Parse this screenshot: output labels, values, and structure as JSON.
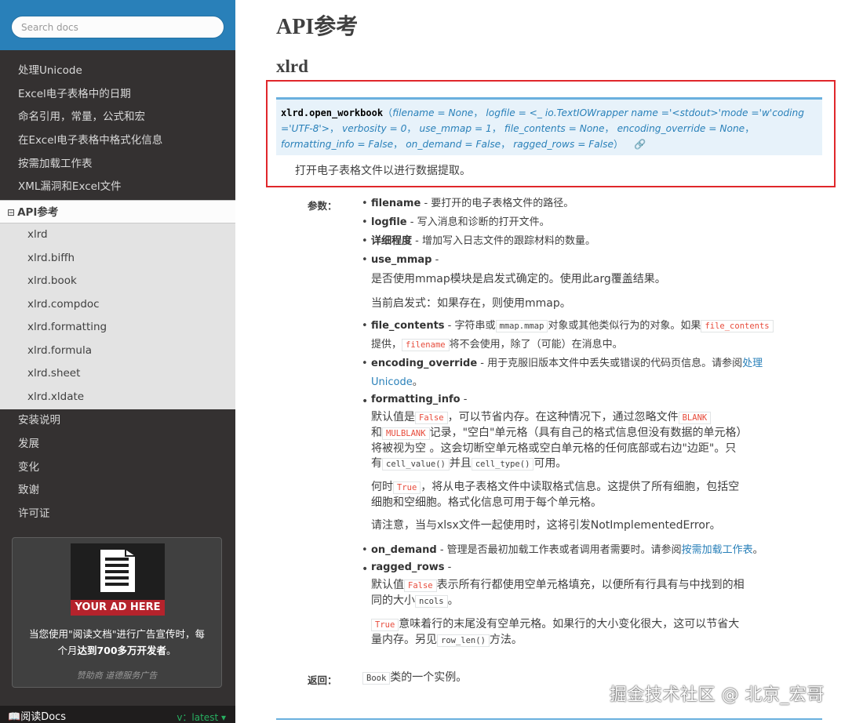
{
  "sidebar": {
    "search_placeholder": "Search docs",
    "nav_top": [
      "处理Unicode",
      "Excel电子表格中的日期",
      "命名引用，常量，公式和宏",
      "在Excel电子表格中格式化信息",
      "按需加载工作表",
      "XML漏洞和Excel文件"
    ],
    "current": {
      "toggle": "⊟",
      "label": "API参考"
    },
    "sub_items": [
      "xlrd",
      "xlrd.biffh",
      "xlrd.book",
      "xlrd.compdoc",
      "xlrd.formatting",
      "xlrd.formula",
      "xlrd.sheet",
      "xlrd.xldate"
    ],
    "nav_bottom": [
      "安装说明",
      "发展",
      "变化",
      "致谢",
      "许可证"
    ],
    "ad": {
      "banner": "YOUR AD HERE",
      "line1": "当您使用\"阅读文档\"进行广告宣传时，每",
      "line2a": "个月",
      "line2b": "达到700多万开发者",
      "line2c": "。",
      "footer": "赞助商 道德服务广告"
    },
    "rtd": {
      "left": "阅读Docs",
      "right": "v：latest ▾"
    }
  },
  "main": {
    "h1": "API参考",
    "h2": "xlrd",
    "sig": {
      "name": "xlrd.open_workbook",
      "paren_open": "（",
      "params": [
        "filename = None",
        "logfile = <_ io.TextIOWrapper name ='<stdout>'mode ='w'coding ='UTF-8'>",
        "verbosity = 0",
        "use_mmap = 1",
        "file_contents = None",
        "encoding_override = None",
        "formatting_info = False",
        "on_demand = False",
        "ragged_rows = False"
      ],
      "paren_close": "）",
      "link_icon": "🔗"
    },
    "description": "打开电子表格文件以进行数据提取。",
    "params_label": "参数：",
    "returns_label": "返回：",
    "params": {
      "filename": {
        "name": "filename",
        "text": " - 要打开的电子表格文件的路径。"
      },
      "logfile": {
        "name": "logfile",
        "text": " - 写入消息和诊断的打开文件。"
      },
      "verbosity": {
        "name": "详细程度",
        "text": " - 增加写入日志文件的跟踪材料的数量。"
      },
      "use_mmap": {
        "name": "use_mmap",
        "text": " -",
        "l2": "是否使用mmap模块是启发式确定的。使用此arg覆盖结果。",
        "l3": "当前启发式：如果存在，则使用mmap。"
      },
      "file_contents": {
        "name": "file_contents",
        "t1": " - 字符串或",
        "c1": "mmap.mmap",
        "t2": "对象或其他类似行为的对象。如果",
        "c2": "file_contents",
        "t3": "提供，",
        "c3": "filename",
        "t4": "将不会使用，除了（可能）在消息中。"
      },
      "encoding_override": {
        "name": "encoding_override",
        "t1": " - 用于克服旧版本文件中丢失或错误的代码页信息。请参阅",
        "link1": "处理",
        "link2": "Unicode",
        "t2": "。"
      },
      "formatting_info": {
        "name": "formatting_info",
        "t0": " -",
        "a1": "默认值是",
        "c1": "False",
        "a2": "，可以节省内存。在这种情况下，通过忽略文件",
        "c2": "BLANK",
        "b1": "和",
        "c3": "MULBLANK",
        "b2": "记录，\"空白\"单元格（具有自己的格式信息但没有数据的单元格）",
        "d1": "将被视为空 。这会切断空单元格或空白单元格的任何底部或右边\"边距\"。只",
        "e1": "有",
        "c4": "cell_value()",
        "e2": "并且",
        "c5": "cell_type()",
        "e3": "可用。",
        "f1": "何时",
        "c6": "True",
        "f2": "，将从电子表格文件中读取格式信息。这提供了所有细胞，包括空",
        "g1": "细胞和空细胞。格式化信息可用于每个单元格。",
        "h1": "请注意，当与xlsx文件一起使用时，这将引发NotImplementedError。"
      },
      "on_demand": {
        "name": "on_demand",
        "t1": " - 管理是否最初加载工作表或者调用者需要时。请参阅",
        "link": "按需加载工作表",
        "t2": "。"
      },
      "ragged_rows": {
        "name": "ragged_rows",
        "t0": " -",
        "a1": "默认值",
        "c1": "False",
        "a2": "表示所有行都使用空单元格填充，以便所有行具有与中找到的相",
        "b1": "同的大小",
        "c2": "ncols",
        "b2": "。",
        "d1": "",
        "c3": "True",
        "d2": "意味着行的末尾没有空单元格。如果行的大小变化很大，这可以节省大",
        "e1": "量内存。另见",
        "c4": "row_len()",
        "e2": "方法。"
      }
    },
    "returns": {
      "code": "Book",
      "text": "类的一个实例。"
    }
  },
  "watermark": "掘金技术社区 @ 北京_宏哥"
}
